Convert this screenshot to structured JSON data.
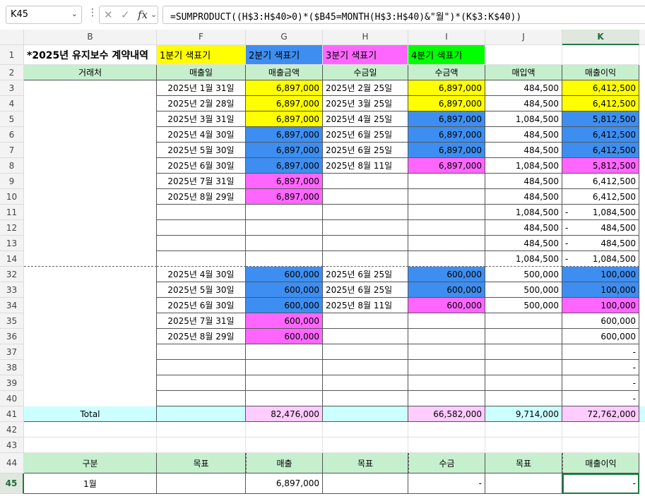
{
  "formula_bar": {
    "name_box": "K45",
    "formula": "=SUMPRODUCT((H$3:H$40>0)*($B45=MONTH(H$3:H$40)&\"월\")*(K$3:K$40))",
    "fx_label": "fx"
  },
  "colors": {
    "header_green": "#c6efce",
    "yellow": "#ffff00",
    "blue": "#3d8ef0",
    "magenta": "#ff66ff",
    "green": "#00ff00",
    "cyan": "#ccffff",
    "pink": "#ffccff"
  },
  "columns": [
    "B",
    "F",
    "G",
    "H",
    "I",
    "J",
    "K"
  ],
  "row1": {
    "title": "*2025년 유지보수 계약내역",
    "legend": [
      "1분기 색표기",
      "2분기 색표기",
      "3분기 색표기",
      "4분기 색표기"
    ]
  },
  "row2": [
    "거래처",
    "매출일",
    "매출금액",
    "수금일",
    "수금액",
    "매입액",
    "매출이익"
  ],
  "rows": [
    {
      "n": "3",
      "F": "2025년 1월 31일",
      "G": "6,897,000",
      "Gc": "yellow",
      "H": "2025년 2월 25일",
      "I": "6,897,000",
      "Ic": "yellow",
      "J": "484,500",
      "K": "6,412,500",
      "Kc": "yellow"
    },
    {
      "n": "4",
      "F": "2025년 2월 28일",
      "G": "6,897,000",
      "Gc": "yellow",
      "H": "2025년 3월 25일",
      "I": "6,897,000",
      "Ic": "yellow",
      "J": "484,500",
      "K": "6,412,500",
      "Kc": "yellow"
    },
    {
      "n": "5",
      "F": "2025년 3월 31일",
      "G": "6,897,000",
      "Gc": "yellow",
      "H": "2025년 4월 25일",
      "I": "6,897,000",
      "Ic": "blue",
      "J": "1,084,500",
      "K": "5,812,500",
      "Kc": "blue"
    },
    {
      "n": "6",
      "F": "2025년 4월 30일",
      "G": "6,897,000",
      "Gc": "blue",
      "H": "2025년 6월 25일",
      "I": "6,897,000",
      "Ic": "blue",
      "J": "484,500",
      "K": "6,412,500",
      "Kc": "blue"
    },
    {
      "n": "7",
      "F": "2025년 5월 30일",
      "G": "6,897,000",
      "Gc": "blue",
      "H": "2025년 6월 25일",
      "I": "6,897,000",
      "Ic": "blue",
      "J": "484,500",
      "K": "6,412,500",
      "Kc": "blue"
    },
    {
      "n": "8",
      "F": "2025년 6월 30일",
      "G": "6,897,000",
      "Gc": "blue",
      "H": "2025년 8월 11일",
      "I": "6,897,000",
      "Ic": "magenta",
      "J": "1,084,500",
      "K": "5,812,500",
      "Kc": "magenta"
    },
    {
      "n": "9",
      "F": "2025년 7월 31일",
      "G": "6,897,000",
      "Gc": "magenta",
      "H": "",
      "I": "",
      "J": "484,500",
      "K": "6,412,500"
    },
    {
      "n": "10",
      "F": "2025년 8월 29일",
      "G": "6,897,000",
      "Gc": "magenta",
      "H": "",
      "I": "",
      "J": "484,500",
      "K": "6,412,500"
    },
    {
      "n": "11",
      "F": "",
      "G": "",
      "H": "",
      "I": "",
      "J": "1,084,500",
      "K": "1,084,500",
      "Kdash": "-"
    },
    {
      "n": "12",
      "F": "",
      "G": "",
      "H": "",
      "I": "",
      "J": "484,500",
      "K": "484,500",
      "Kdash": "-"
    },
    {
      "n": "13",
      "F": "",
      "G": "",
      "H": "",
      "I": "",
      "J": "484,500",
      "K": "484,500",
      "Kdash": "-"
    },
    {
      "n": "14",
      "F": "",
      "G": "",
      "H": "",
      "I": "",
      "J": "1,084,500",
      "K": "1,084,500",
      "Kdash": "-"
    },
    {
      "n": "32",
      "F": "2025년 4월 30일",
      "G": "600,000",
      "Gc": "blue",
      "H": "2025년 6월 25일",
      "I": "600,000",
      "Ic": "blue",
      "J": "500,000",
      "K": "100,000",
      "Kc": "blue"
    },
    {
      "n": "33",
      "F": "2025년 5월 30일",
      "G": "600,000",
      "Gc": "blue",
      "H": "2025년 6월 25일",
      "I": "600,000",
      "Ic": "blue",
      "J": "500,000",
      "K": "100,000",
      "Kc": "blue"
    },
    {
      "n": "34",
      "F": "2025년 6월 30일",
      "G": "600,000",
      "Gc": "blue",
      "H": "2025년 8월 11일",
      "I": "600,000",
      "Ic": "magenta",
      "J": "500,000",
      "K": "100,000",
      "Kc": "magenta"
    },
    {
      "n": "35",
      "F": "2025년 7월 31일",
      "G": "600,000",
      "Gc": "magenta",
      "H": "",
      "I": "",
      "J": "",
      "K": "600,000"
    },
    {
      "n": "36",
      "F": "2025년 8월 29일",
      "G": "600,000",
      "Gc": "magenta",
      "H": "",
      "I": "",
      "J": "",
      "K": "600,000"
    },
    {
      "n": "37",
      "F": "",
      "G": "",
      "H": "",
      "I": "",
      "J": "",
      "K": "-"
    },
    {
      "n": "38",
      "F": "",
      "G": "",
      "H": "",
      "I": "",
      "J": "",
      "K": "-"
    },
    {
      "n": "39",
      "F": "",
      "G": "",
      "H": "",
      "I": "",
      "J": "",
      "K": "-"
    },
    {
      "n": "40",
      "F": "",
      "G": "",
      "H": "",
      "I": "",
      "J": "",
      "K": "-"
    }
  ],
  "total_row": {
    "n": "41",
    "B": "Total",
    "F": "",
    "G": "82,476,000",
    "H": "",
    "I": "66,582,000",
    "J": "9,714,000",
    "K": "72,762,000"
  },
  "blank_rows": [
    "42",
    "43"
  ],
  "summary_header": {
    "n": "44",
    "cells": [
      "구분",
      "목표",
      "매출",
      "목표",
      "수금",
      "목표",
      "매출이익"
    ]
  },
  "summary_row": {
    "n": "45",
    "B": "1월",
    "F": "",
    "G": "6,897,000",
    "H": "",
    "I": "-",
    "J": "",
    "K": "-"
  }
}
